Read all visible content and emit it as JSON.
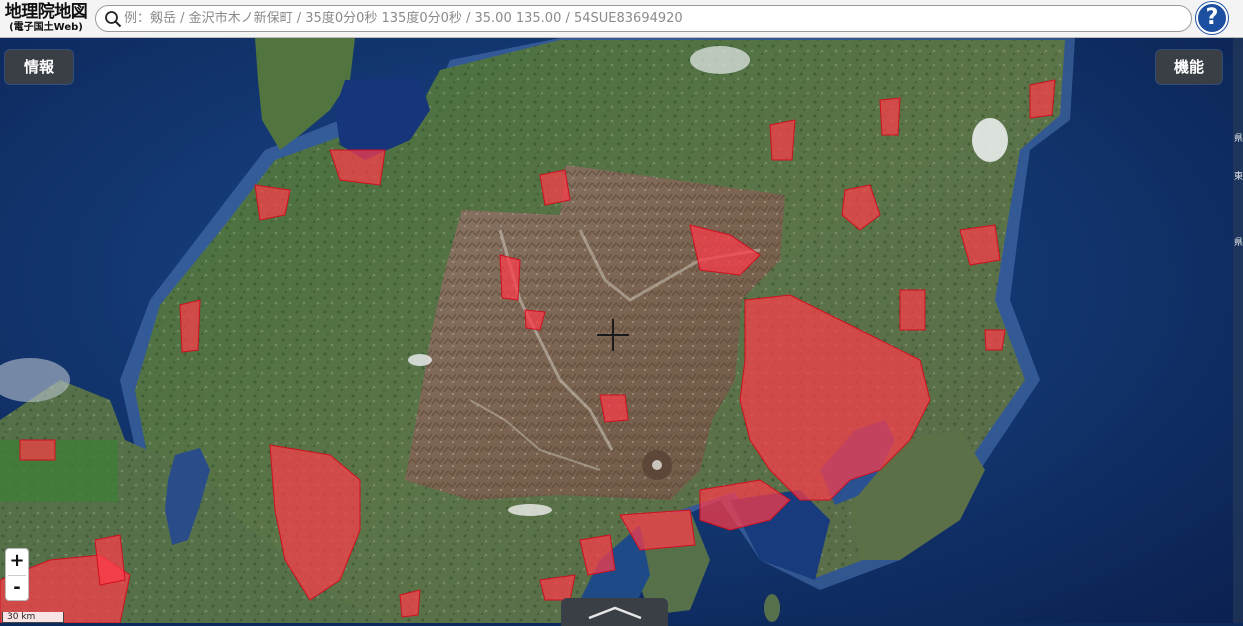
{
  "app": {
    "logo_main": "地理院地図",
    "logo_sub": "(電子国土Web)"
  },
  "search": {
    "placeholder": "例：剱岳 / 金沢市木ノ新保町 / 35度0分0秒 135度0分0秒 / 35.00 135.00 / 54SUE83694920",
    "value": ""
  },
  "help": {
    "label": "?"
  },
  "buttons": {
    "info_label": "情報",
    "features_label": "機能"
  },
  "zoom": {
    "in_label": "+",
    "out_label": "-"
  },
  "scale": {
    "label": "30 km"
  },
  "right_strip": {
    "chars": [
      "県",
      "東",
      "県"
    ]
  },
  "colors": {
    "sea": "#10306a",
    "land_green": "#3f6a35",
    "urban": "#ff3b4a",
    "header_bg": "#f4f4f4",
    "panel_button": "#3a3f45",
    "help_button": "#1d4fa0"
  },
  "icons": {
    "search": "search-icon",
    "center_crosshair": "crosshair-icon",
    "bottom_tab": "chevron-up-icon"
  }
}
